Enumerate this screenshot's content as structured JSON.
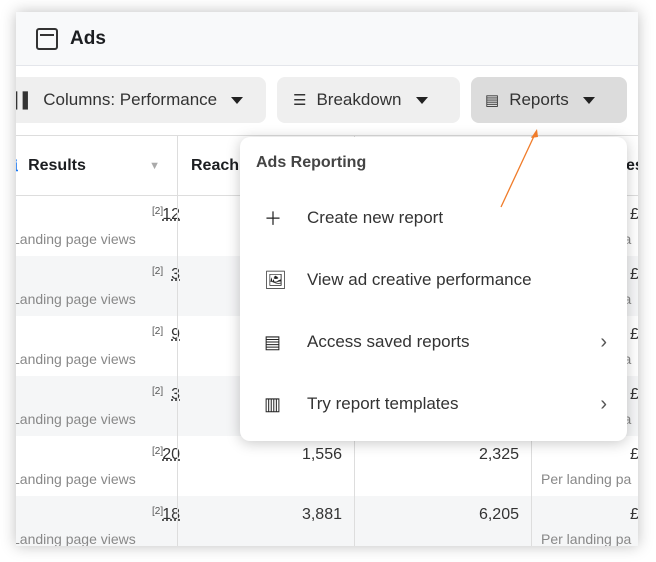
{
  "header": {
    "title": "Ads",
    "icon": "window-icon"
  },
  "toolbar": {
    "columns": "Columns: Performance",
    "breakdown": "Breakdown",
    "reports": "Reports"
  },
  "table": {
    "headers": {
      "results": "Results",
      "reach": "Reach",
      "last": "es"
    },
    "rows": [
      {
        "results": "12",
        "ref": "[2]",
        "label": "Landing page views",
        "reach": "",
        "impr": "",
        "cost": "£",
        "cost_label": "Per landing pa"
      },
      {
        "results": "3",
        "ref": "[2]",
        "label": "Landing page views",
        "reach": "",
        "impr": "",
        "cost": "£",
        "cost_label": "Per landing pa"
      },
      {
        "results": "9",
        "ref": "[2]",
        "label": "Landing page views",
        "reach": "",
        "impr": "",
        "cost": "£",
        "cost_label": "Per landing pa"
      },
      {
        "results": "3",
        "ref": "[2]",
        "label": "Landing page views",
        "reach": "",
        "impr": "",
        "cost": "£",
        "cost_label": "Per landing pa"
      },
      {
        "results": "20",
        "ref": "[2]",
        "label": "Landing page views",
        "reach": "1,556",
        "impr": "2,325",
        "cost": "£",
        "cost_label": "Per landing pa"
      },
      {
        "results": "18",
        "ref": "[2]",
        "label": "Landing page views",
        "reach": "3,881",
        "impr": "6,205",
        "cost": "£",
        "cost_label": "Per landing pa"
      }
    ]
  },
  "menu": {
    "title": "Ads Reporting",
    "items": [
      {
        "label": "Create new report",
        "icon": "plus-icon"
      },
      {
        "label": "View ad creative performance",
        "icon": "image-icon"
      },
      {
        "label": "Access saved reports",
        "icon": "reports-icon",
        "submenu": true
      },
      {
        "label": "Try report templates",
        "icon": "notebook-icon",
        "submenu": true
      }
    ]
  },
  "annotation_color": "#f07c2a"
}
